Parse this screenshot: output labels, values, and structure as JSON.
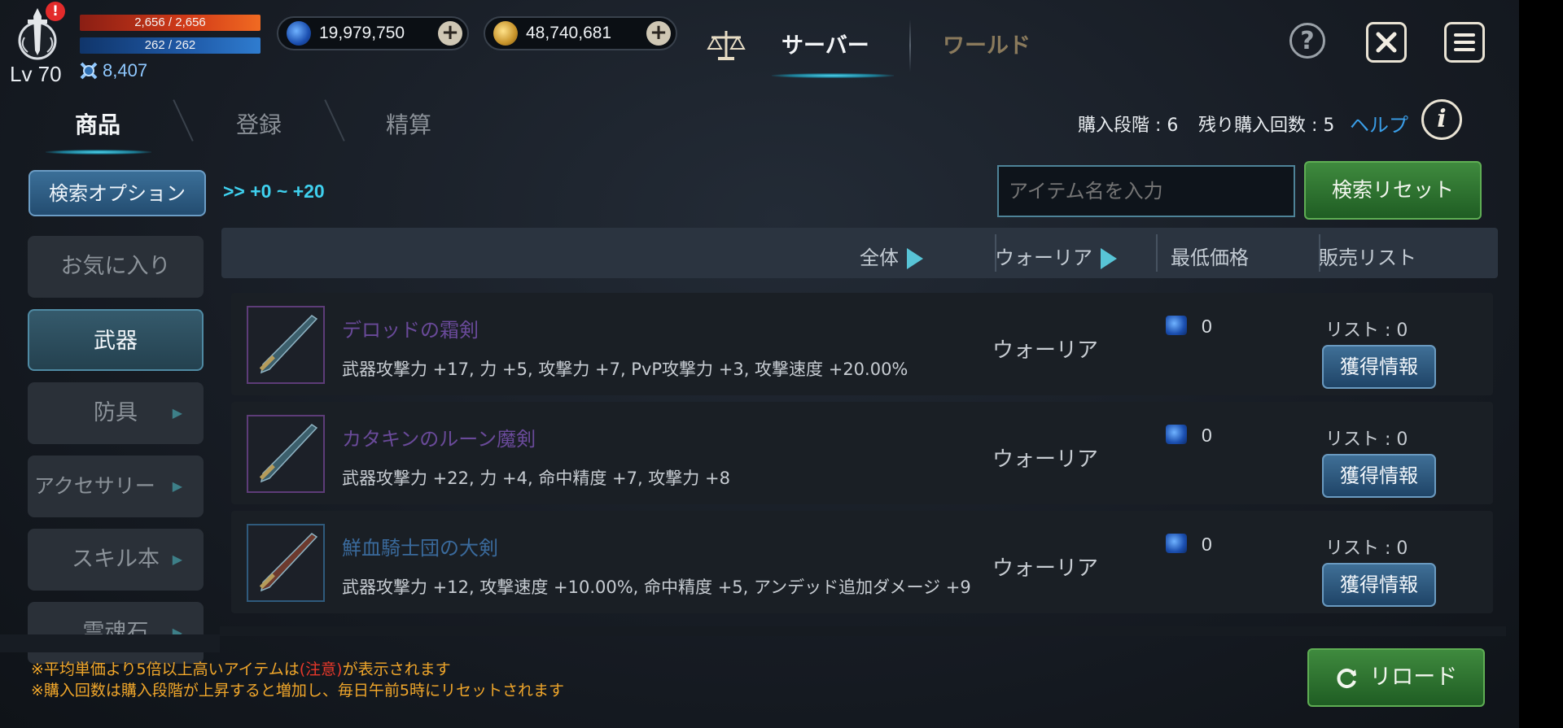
{
  "player": {
    "level": "Lv 70",
    "hp": "2,656 / 2,656",
    "mp": "262 / 262",
    "combat_power": "8,407",
    "alert": "!"
  },
  "currency": {
    "gems": "19,979,750",
    "gold": "48,740,681",
    "plus": "+"
  },
  "top_tabs": {
    "server": "サーバー",
    "world": "ワールド"
  },
  "top_buttons": {
    "help": "?",
    "close": "✕"
  },
  "sub_tabs": {
    "products": "商品",
    "register": "登録",
    "settle": "精算"
  },
  "purchase_info": {
    "stage": "購入段階 : 6",
    "remaining": "残り購入回数 : 5",
    "help_link": "ヘルプ",
    "info": "i"
  },
  "search": {
    "options_label": "検索オプション",
    "range": ">> +0 ~ +20",
    "placeholder": "アイテム名を入力",
    "reset_label": "検索リセット"
  },
  "sidebar": [
    {
      "label": "お気に入り",
      "active": false,
      "arrow": false
    },
    {
      "label": "武器",
      "active": true,
      "arrow": false
    },
    {
      "label": "防具",
      "active": false,
      "arrow": true
    },
    {
      "label": "アクセサリー",
      "active": false,
      "arrow": true
    },
    {
      "label": "スキル本",
      "active": false,
      "arrow": true
    },
    {
      "label": "霊魂石",
      "active": false,
      "arrow": true
    }
  ],
  "table_header": {
    "all": "全体",
    "class_filter": "ウォーリア",
    "min_price": "最低価格",
    "sale_list": "販売リスト"
  },
  "items": [
    {
      "name": "デロッドの霜剣",
      "stats": "武器攻撃力 +17, 力 +5, 攻撃力 +7, PvP攻撃力 +3, 攻撃速度 +20.00%",
      "class": "ウォーリア",
      "price": "0",
      "list": "リスト : 0",
      "button": "獲得情報",
      "rarity_color": "#6a4a9a"
    },
    {
      "name": "カタキンのルーン魔剣",
      "stats": "武器攻撃力 +22, 力 +4, 命中精度 +7, 攻撃力 +8",
      "class": "ウォーリア",
      "price": "0",
      "list": "リスト : 0",
      "button": "獲得情報",
      "rarity_color": "#6a4a9a"
    },
    {
      "name": "鮮血騎士団の大剣",
      "stats": "武器攻撃力 +12, 攻撃速度 +10.00%, 命中精度 +5, アンデッド追加ダメージ +9",
      "class": "ウォーリア",
      "price": "0",
      "list": "リスト : 0",
      "button": "獲得情報",
      "rarity_color": "#3a6a9c"
    }
  ],
  "footer": {
    "note1_before": "※平均単価より5倍以上高いアイテムは",
    "note1_warn": "(注意)",
    "note1_after": "が表示されます",
    "note2": "※購入回数は購入段階が上昇すると増加し、毎日午前5時にリセットされます",
    "reload_label": "リロード"
  },
  "colors": {
    "accent_cyan": "#3fd0ee",
    "green_button": "#3f8a3e",
    "blue_button": "#3f6f96",
    "note_orange": "#f0a62a",
    "note_red": "#e9382a"
  }
}
